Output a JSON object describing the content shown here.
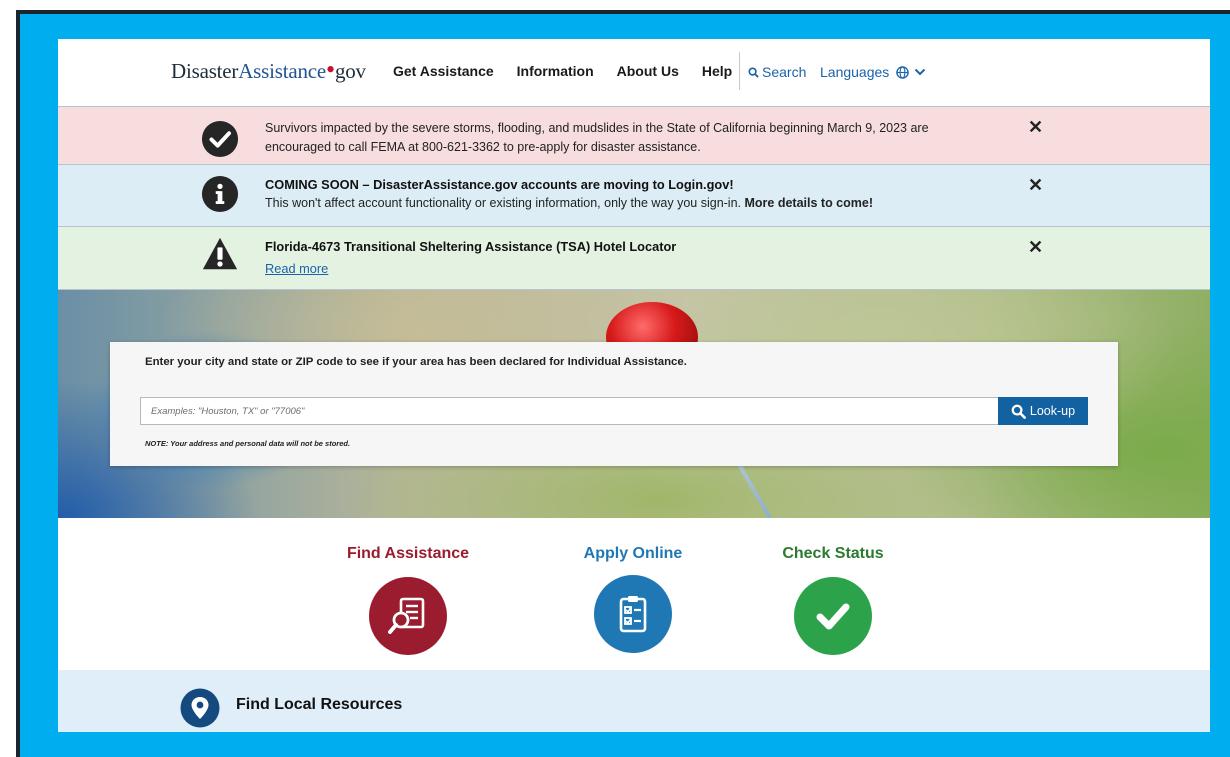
{
  "header": {
    "logo_part1": "Disaster",
    "logo_part2": "Assistance",
    "logo_dot": "•",
    "logo_part3": "gov",
    "nav": [
      {
        "label": "Get Assistance"
      },
      {
        "label": "Information"
      },
      {
        "label": "About Us"
      },
      {
        "label": "Help"
      }
    ],
    "search_label": "Search",
    "languages_label": "Languages"
  },
  "alerts": [
    {
      "icon": "check-circle-icon",
      "text": "Survivors impacted by the severe storms, flooding, and mudslides in the State of California beginning March 9, 2023 are encouraged to call FEMA at 800-621-3362 to pre-apply for disaster assistance.",
      "close": "✕"
    },
    {
      "icon": "info-icon",
      "title": "COMING SOON – DisasterAssistance.gov accounts are moving to Login.gov!",
      "text": "This won't affect account functionality or existing information, only the way you sign-in.",
      "text_bold": "More details to come!",
      "close": "✕"
    },
    {
      "icon": "warning-icon",
      "title": "Florida-4673 Transitional Sheltering Assistance (TSA) Hotel Locator",
      "link": "Read more",
      "close": "✕"
    }
  ],
  "lookup": {
    "title": "Enter your city and state or ZIP code to see if your area has been declared for Individual Assistance.",
    "placeholder": "Examples: \"Houston, TX\" or \"77006\"",
    "button_label": "Look-up",
    "note": "NOTE: Your address and personal data will not be stored."
  },
  "actions": [
    {
      "label": "Find Assistance",
      "icon": "document-search-icon"
    },
    {
      "label": "Apply Online",
      "icon": "clipboard-checklist-icon"
    },
    {
      "label": "Check Status",
      "icon": "checkmark-icon"
    }
  ],
  "local_resources": {
    "label": "Find Local Resources",
    "icon": "map-pin-icon"
  },
  "colors": {
    "frame": "#00aef0",
    "find_assistance": "#9b1c2e",
    "apply_online": "#1f78b4",
    "check_status": "#2ca24a",
    "lookup_button": "#1261a0"
  }
}
